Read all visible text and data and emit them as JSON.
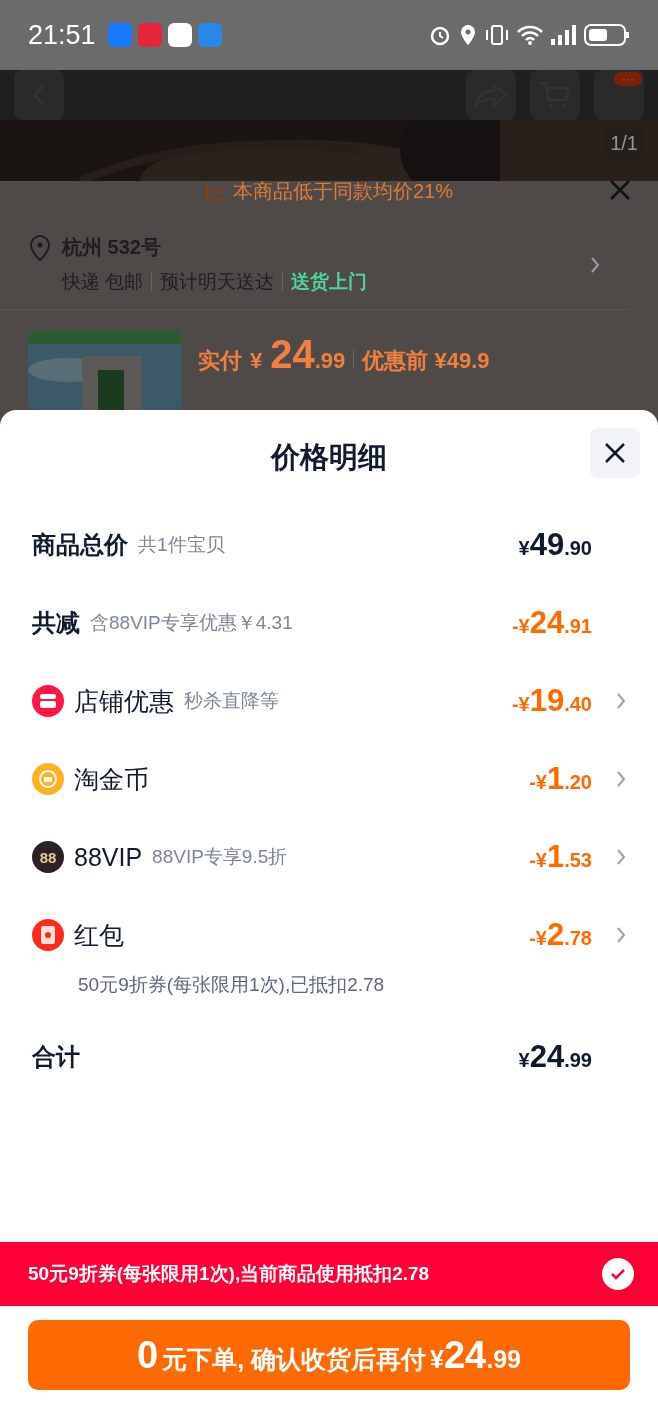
{
  "status_bar": {
    "time": "21:51"
  },
  "nav": {
    "badge": "···",
    "page_counter": "1/1"
  },
  "behind_sheet": {
    "banner": "本商品低于同款均价21%",
    "address": "杭州 532号",
    "delivery": [
      "快递 包邮",
      "预计明天送达"
    ],
    "delivery_highlight": "送货上门",
    "pay_label": "实付",
    "pay_amount": "¥24.99",
    "before_label": "优惠前 ¥49.9"
  },
  "sheet": {
    "title": "价格明细",
    "rows": [
      {
        "kind": "header",
        "label": "商品总价",
        "note": "共1件宝贝",
        "amount": "¥49.90",
        "discount": false,
        "chevron": false
      },
      {
        "kind": "header",
        "label": "共减",
        "note": "含88VIP专享优惠￥4.31",
        "amount": "-¥24.91",
        "discount": true,
        "chevron": false
      },
      {
        "kind": "shop",
        "label": "店铺优惠",
        "note": "秒杀直降等",
        "amount": "-¥19.40",
        "discount": true,
        "chevron": true
      },
      {
        "kind": "coin",
        "label": "淘金币",
        "amount": "-¥1.20",
        "discount": true,
        "chevron": true
      },
      {
        "kind": "vip",
        "icon_text": "88",
        "label": "88VIP",
        "note": "88VIP专享9.5折",
        "amount": "-¥1.53",
        "discount": true,
        "chevron": true
      },
      {
        "kind": "packet",
        "label": "红包",
        "amount": "-¥2.78",
        "discount": true,
        "chevron": true,
        "detail": "50元9折券(每张限用1次),已抵扣2.78"
      },
      {
        "kind": "header",
        "label": "合计",
        "amount": "¥24.99",
        "discount": false,
        "chevron": false
      }
    ]
  },
  "coupon_bar": {
    "text": "50元9折券(每张限用1次),当前商品使用抵扣2.78",
    "checked": true
  },
  "order_button": {
    "lead": "0",
    "text": "元下单, 确认收货后再付",
    "amount": "¥24.99"
  }
}
